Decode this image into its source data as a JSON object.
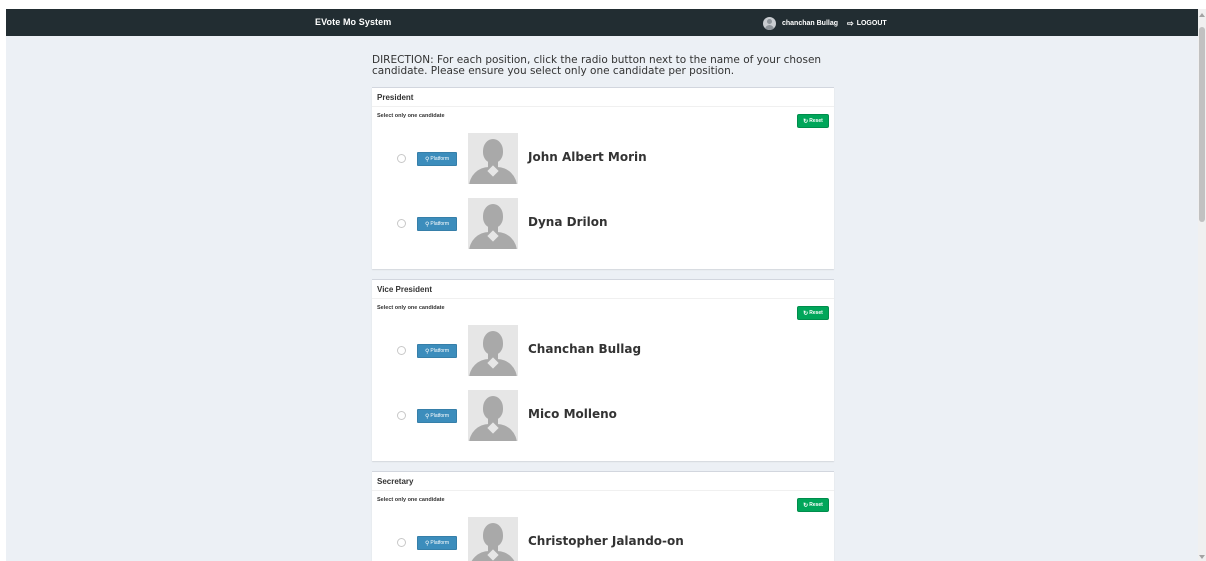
{
  "navbar": {
    "brand": "EVote Mo System",
    "user_name": "chanchan Bullag",
    "logout_label": "LOGOUT"
  },
  "direction": "DIRECTION: For each position, click the radio button next to the name of your chosen candidate. Please ensure you select only one candidate per position.",
  "common": {
    "hint": "Select only one candidate",
    "reset_label": "Reset",
    "platform_label": "Platform"
  },
  "positions": [
    {
      "title": "President",
      "candidates": [
        {
          "name": "John Albert Morin"
        },
        {
          "name": "Dyna Drilon"
        }
      ]
    },
    {
      "title": "Vice President",
      "candidates": [
        {
          "name": "Chanchan Bullag"
        },
        {
          "name": "Mico Molleno"
        }
      ]
    },
    {
      "title": "Secretary",
      "candidates": [
        {
          "name": "Christopher Jalando-on"
        }
      ]
    }
  ],
  "colors": {
    "navbar": "#222d32",
    "background": "#ecf0f5",
    "reset_button": "#00a65a",
    "platform_button": "#3c8dbc"
  },
  "icons": {
    "user": "user-avatar-icon",
    "logout": "sign-out-icon",
    "reset": "refresh-icon",
    "platform": "search-icon",
    "candidate_photo": "default-avatar-icon"
  }
}
